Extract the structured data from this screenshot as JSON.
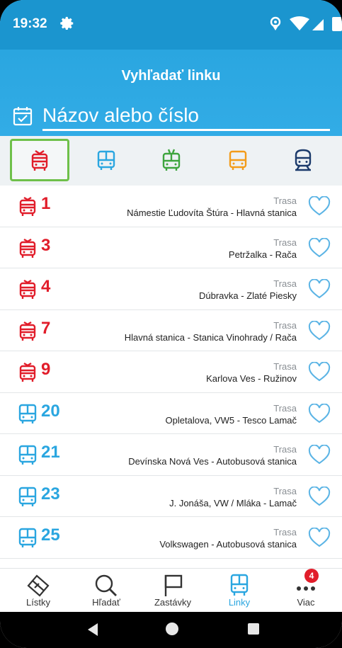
{
  "status_bar": {
    "time": "19:32"
  },
  "header": {
    "title": "Vyhľadať linku",
    "search_placeholder": "Názov alebo číslo"
  },
  "transport_types": [
    {
      "name": "tram",
      "color": "#e11d2a",
      "selected": true
    },
    {
      "name": "bus",
      "color": "#2aa6e0",
      "selected": false
    },
    {
      "name": "trolleybus",
      "color": "#3ea53e",
      "selected": false
    },
    {
      "name": "night-bus",
      "color": "#f39c1a",
      "selected": false
    },
    {
      "name": "train",
      "color": "#1b3a6b",
      "selected": false
    }
  ],
  "lines": [
    {
      "number": "1",
      "type": "tram",
      "label": "Trasa",
      "route": "Námestie Ľudovíta Štúra - Hlavná stanica"
    },
    {
      "number": "3",
      "type": "tram",
      "label": "Trasa",
      "route": "Petržalka - Rača"
    },
    {
      "number": "4",
      "type": "tram",
      "label": "Trasa",
      "route": "Dúbravka - Zlaté Piesky"
    },
    {
      "number": "7",
      "type": "tram",
      "label": "Trasa",
      "route": "Hlavná stanica - Stanica Vinohrady / Rača"
    },
    {
      "number": "9",
      "type": "tram",
      "label": "Trasa",
      "route": "Karlova Ves - Ružinov"
    },
    {
      "number": "20",
      "type": "bus",
      "label": "Trasa",
      "route": "Opletalova, VW5 - Tesco Lamač"
    },
    {
      "number": "21",
      "type": "bus",
      "label": "Trasa",
      "route": "Devínska Nová Ves - Autobusová stanica"
    },
    {
      "number": "23",
      "type": "bus",
      "label": "Trasa",
      "route": "J. Jonáša, VW / Mláka - Lamač"
    },
    {
      "number": "25",
      "type": "bus",
      "label": "Trasa",
      "route": "Volkswagen - Autobusová stanica"
    }
  ],
  "colors": {
    "tram": "#e11d2a",
    "bus": "#2aa6e0",
    "accent": "#2aa6e0"
  },
  "bottom_nav": [
    {
      "label": "Lístky",
      "icon": "ticket-icon",
      "active": false
    },
    {
      "label": "Hľadať",
      "icon": "search-icon",
      "active": false
    },
    {
      "label": "Zastávky",
      "icon": "flag-icon",
      "active": false
    },
    {
      "label": "Linky",
      "icon": "bus-icon",
      "active": true
    },
    {
      "label": "Viac",
      "icon": "more-icon",
      "active": false,
      "badge": "4"
    }
  ]
}
